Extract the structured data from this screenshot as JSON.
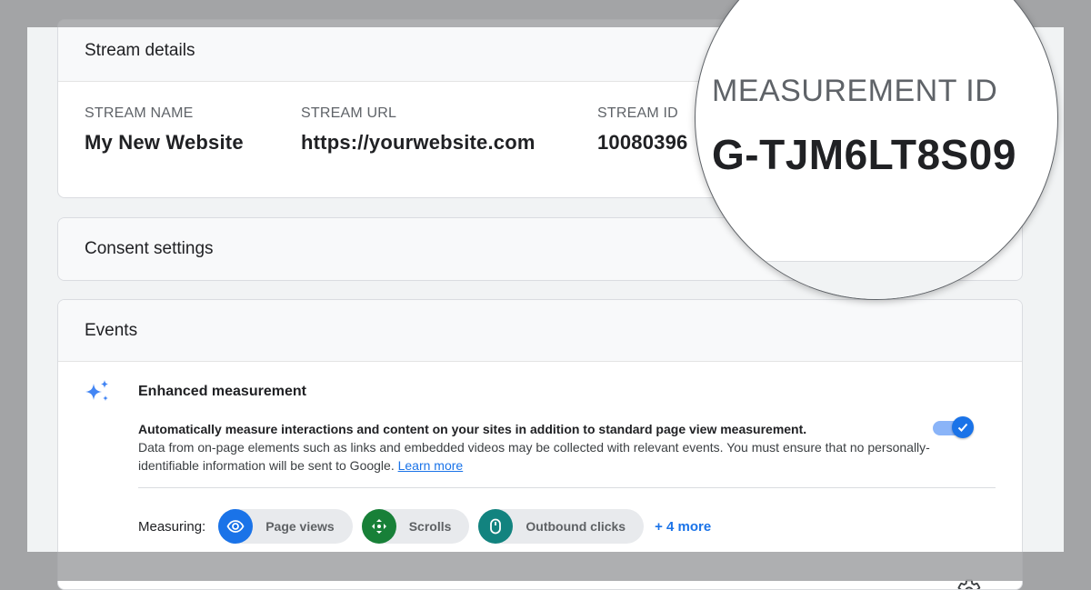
{
  "stream_details": {
    "header": "Stream details",
    "fields": [
      {
        "label": "STREAM NAME",
        "value": "My New Website"
      },
      {
        "label": "STREAM URL",
        "value": "https://yourwebsite.com"
      },
      {
        "label": "STREAM ID",
        "value": "10080396"
      }
    ]
  },
  "magnifier": {
    "label": "MEASUREMENT ID",
    "value": "G-TJM6LT8S09"
  },
  "consent": {
    "header": "Consent settings",
    "icon": "chevron-down-icon"
  },
  "events": {
    "header": "Events",
    "enhanced": {
      "title": "Enhanced measurement",
      "lead": "Automatically measure interactions and content on your sites in addition to standard page view measurement.",
      "body": "Data from on-page elements such as links and embedded videos may be collected with relevant events. You must ensure that no personally-identifiable information will be sent to Google.",
      "link": "Learn more",
      "toggle_on": true
    },
    "measuring": {
      "label": "Measuring:",
      "chips": [
        {
          "label": "Page views",
          "icon": "eye-icon",
          "color": "#1a73e8"
        },
        {
          "label": "Scrolls",
          "icon": "move-icon",
          "color": "#188038"
        },
        {
          "label": "Outbound clicks",
          "icon": "mouse-icon",
          "color": "#12837f"
        }
      ],
      "more": "+ 4 more"
    },
    "settings_icon": "gear-icon"
  },
  "colors": {
    "accent": "#1a73e8",
    "backdrop": "#a3a4a6"
  }
}
